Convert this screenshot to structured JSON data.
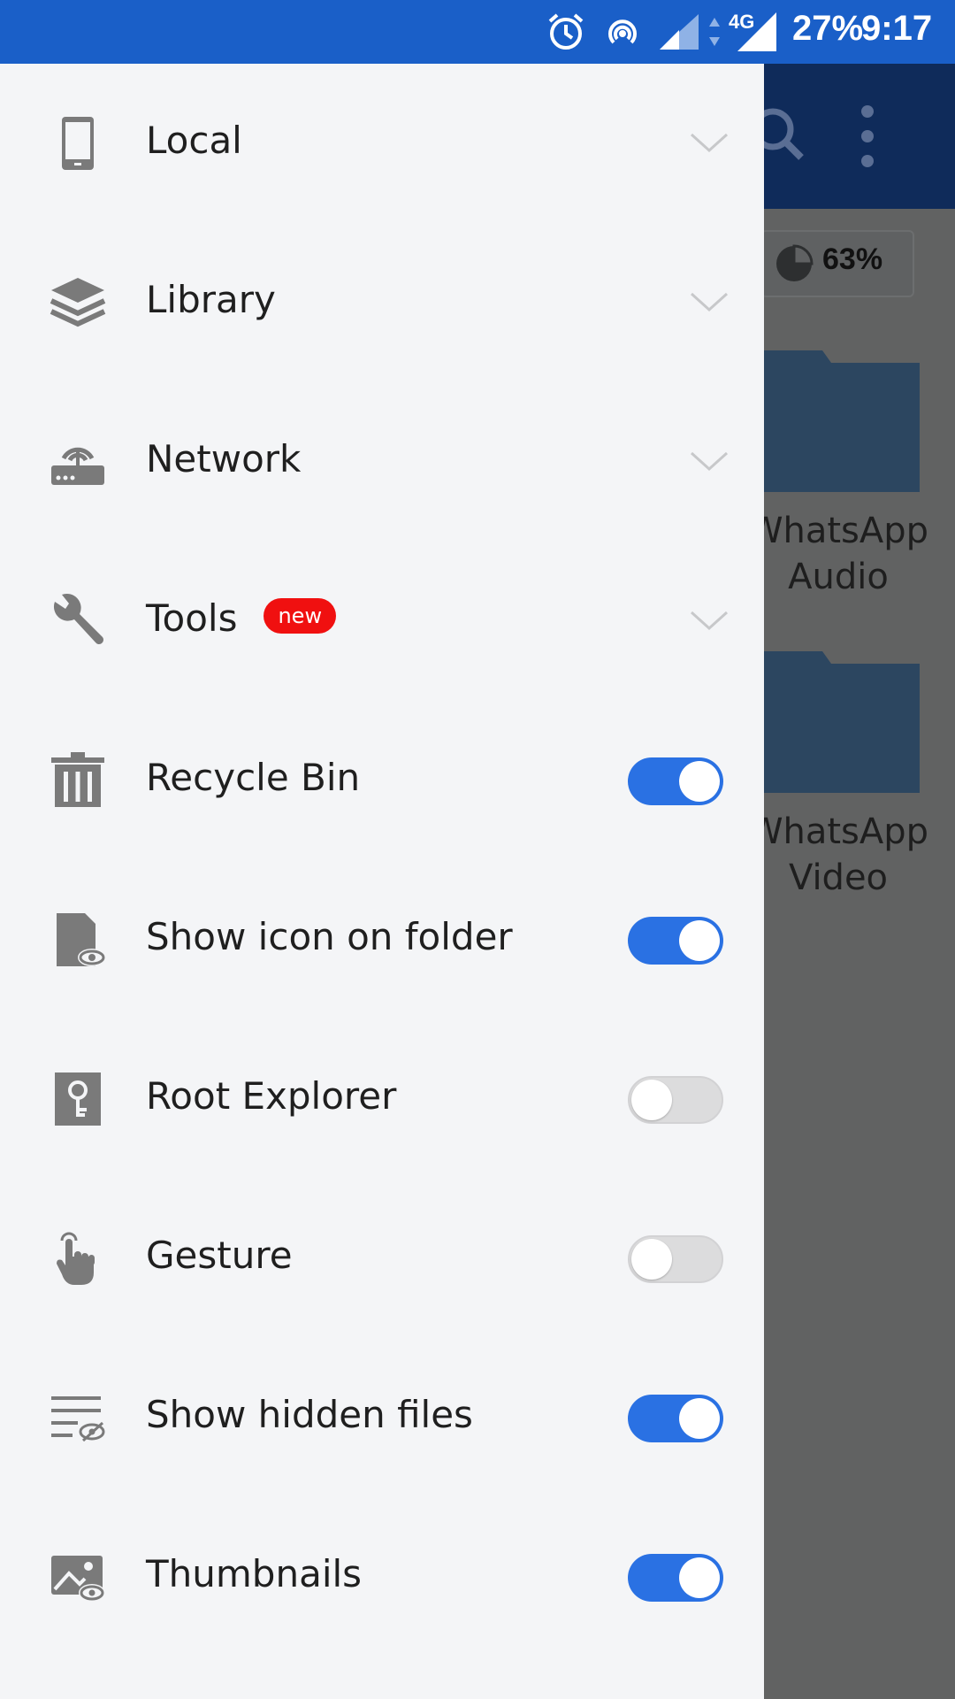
{
  "status_bar": {
    "network": "4G",
    "battery": "27%",
    "time": "9:17"
  },
  "background": {
    "storage_percent": "63%",
    "folders": [
      {
        "label_line1": "WhatsApp",
        "label_line2": "Audio"
      },
      {
        "label_line1": "WhatsApp",
        "label_line2": "Video"
      }
    ]
  },
  "drawer": {
    "items": [
      {
        "label": "Local",
        "icon": "phone-icon",
        "type": "expand"
      },
      {
        "label": "Library",
        "icon": "layers-icon",
        "type": "expand"
      },
      {
        "label": "Network",
        "icon": "router-icon",
        "type": "expand"
      },
      {
        "label": "Tools",
        "icon": "wrench-icon",
        "type": "expand",
        "badge": "new"
      },
      {
        "label": "Recycle Bin",
        "icon": "trash-icon",
        "type": "toggle",
        "on": true
      },
      {
        "label": "Show icon on folder",
        "icon": "folder-eye-icon",
        "type": "toggle",
        "on": true
      },
      {
        "label": "Root Explorer",
        "icon": "key-icon",
        "type": "toggle",
        "on": false
      },
      {
        "label": "Gesture",
        "icon": "hand-icon",
        "type": "toggle",
        "on": false
      },
      {
        "label": "Show hidden files",
        "icon": "hidden-list-icon",
        "type": "toggle",
        "on": true
      },
      {
        "label": "Thumbnails",
        "icon": "image-eye-icon",
        "type": "toggle",
        "on": true
      }
    ]
  },
  "colors": {
    "status_bar": "#1a5fc8",
    "toggle_on": "#2a71e3",
    "toggle_off": "#dcdcdd",
    "badge": "#f01010",
    "drawer_bg": "#f4f5f7",
    "icon": "#7a7a7a"
  }
}
